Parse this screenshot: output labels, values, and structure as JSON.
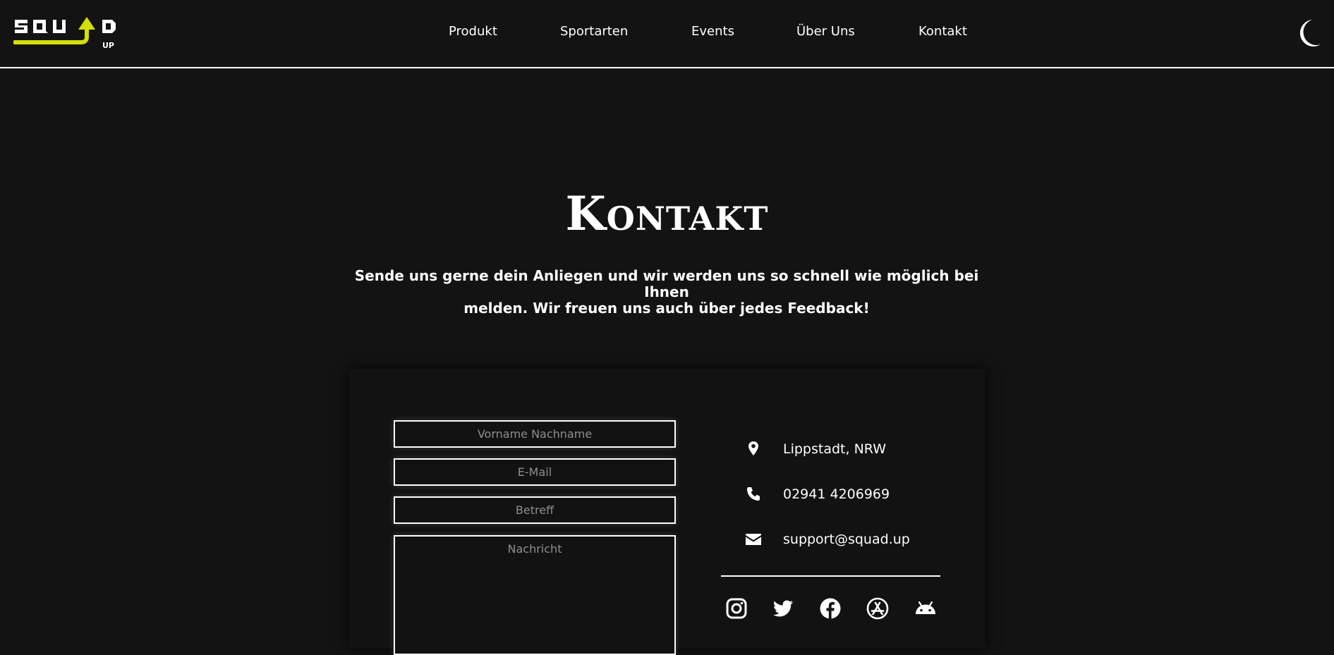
{
  "brand": {
    "logo_text": "SQUAD UP",
    "logo_colors": {
      "letters": "#ffffff",
      "accent": "#d4e000"
    }
  },
  "nav": {
    "items": [
      {
        "label": "Produkt"
      },
      {
        "label": "Sportarten"
      },
      {
        "label": "Events"
      },
      {
        "label": "Über Uns"
      },
      {
        "label": "Kontakt"
      }
    ]
  },
  "theme_toggle": {
    "icon": "moon-icon"
  },
  "hero": {
    "title": "Kontakt",
    "subtitle_line1": "Sende uns gerne dein Anliegen und wir werden uns so schnell wie möglich bei Ihnen",
    "subtitle_line2": "melden. Wir freuen uns auch über jedes Feedback!"
  },
  "form": {
    "name_placeholder": "Vorname Nachname",
    "email_placeholder": "E-Mail",
    "subject_placeholder": "Betreff",
    "message_placeholder": "Nachricht"
  },
  "contact": {
    "location": {
      "icon": "map-pin-icon",
      "text": "Lippstadt, NRW"
    },
    "phone": {
      "icon": "phone-icon",
      "text": "02941 4206969"
    },
    "email": {
      "icon": "envelope-icon",
      "text": "support@squad.up"
    }
  },
  "social": [
    {
      "icon": "instagram-icon"
    },
    {
      "icon": "twitter-icon"
    },
    {
      "icon": "facebook-icon"
    },
    {
      "icon": "app-store-icon"
    },
    {
      "icon": "android-icon"
    }
  ],
  "colors": {
    "background": "#131313",
    "text": "#ffffff",
    "placeholder": "#8e8e8e",
    "accent": "#d4e000"
  }
}
